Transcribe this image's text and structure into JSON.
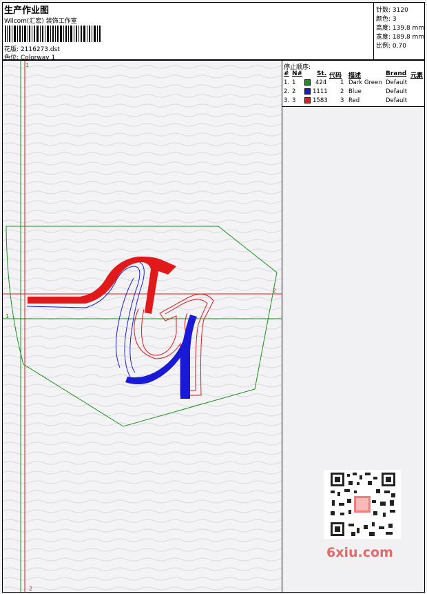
{
  "header": {
    "title": "生产作业图",
    "subtitle": "Wilcom(汇宏) 装饰工作室",
    "design_label": "花版:",
    "design_value": "2116273.dst",
    "colorway_label": "色位:",
    "colorway_value": "Colorway 1"
  },
  "stats": {
    "stitches_label": "针数:",
    "stitches_value": "3120",
    "colors_label": "颜色:",
    "colors_value": "3",
    "height_label": "高度:",
    "height_value": "139.8 mm",
    "width_label": "宽度:",
    "width_value": "189.8 mm",
    "scale_label": "比例:",
    "scale_value": "0.70"
  },
  "legend": {
    "title": "停止顺序:",
    "columns": [
      "#",
      "N#",
      "St.",
      "代码",
      "描述",
      "Brand",
      "元素"
    ],
    "rows": [
      {
        "idx": "1.",
        "n": "1",
        "color": "#1a8f1a",
        "st": "424",
        "code": "1",
        "desc": "Dark Green",
        "brand": "Default"
      },
      {
        "idx": "2.",
        "n": "2",
        "color": "#1a1ad6",
        "st": "1111",
        "code": "2",
        "desc": "Blue",
        "brand": "Default"
      },
      {
        "idx": "3.",
        "n": "3",
        "color": "#e01a1a",
        "st": "1583",
        "code": "3",
        "desc": "Red",
        "brand": "Default"
      }
    ]
  },
  "guides": {
    "top_mark": "1",
    "left_mark": "1",
    "right_mark": "2",
    "bottom_mark": "2"
  },
  "watermark": "6xiu.com",
  "colors": {
    "green": "#1a8f1a",
    "blue": "#1a1ad6",
    "red": "#e01a1a"
  }
}
